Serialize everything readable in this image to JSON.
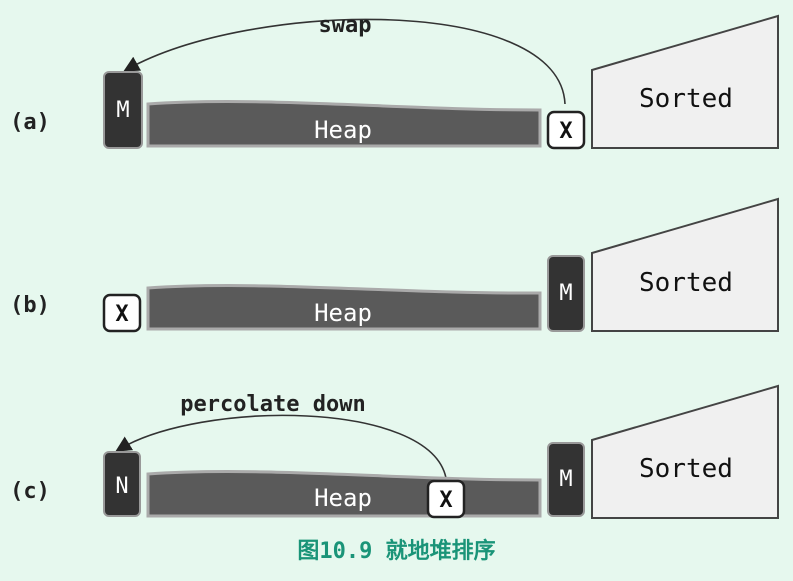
{
  "rows": [
    {
      "label": "(a)",
      "top_note": "swap",
      "left_box": "M",
      "heap": "Heap",
      "marker": "X",
      "sorted": "Sorted"
    },
    {
      "label": "(b)",
      "left_box": "X",
      "heap": "Heap",
      "right_box": "M",
      "sorted": "Sorted"
    },
    {
      "label": "(c)",
      "top_note": "percolate down",
      "left_box": "N",
      "heap": "Heap",
      "marker": "X",
      "right_box": "M",
      "sorted": "Sorted"
    }
  ],
  "caption": "图10.9 就地堆排序",
  "colors": {
    "background": "#e6f8ee",
    "heap_fill": "#5a5a5a",
    "dark_box": "#333333",
    "sorted_fill": "#f0f0f0",
    "caption": "#1a9478"
  }
}
